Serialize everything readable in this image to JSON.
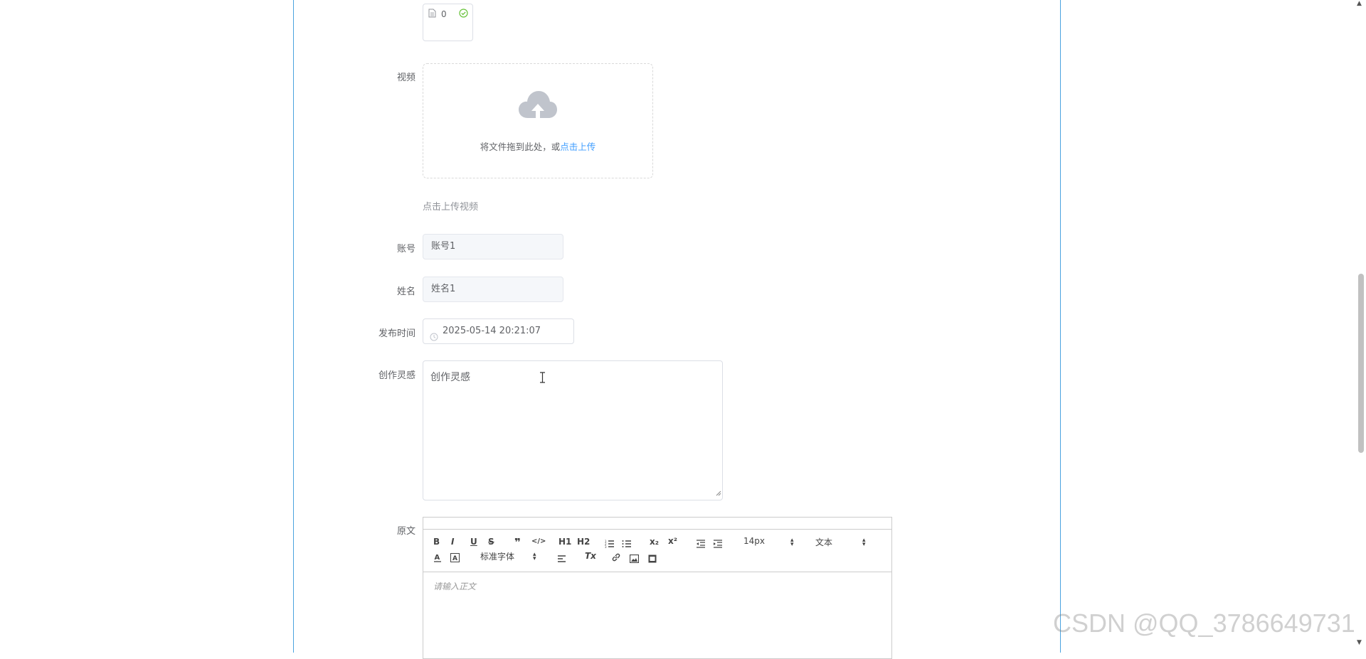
{
  "uploaded_file": {
    "name": "0"
  },
  "video": {
    "label": "视频",
    "upload_tip_prefix": "将文件拖到此处，或",
    "upload_tip_link": "点击上传",
    "hint": "点击上传视频"
  },
  "account": {
    "label": "账号",
    "value": "账号1"
  },
  "name": {
    "label": "姓名",
    "value": "姓名1"
  },
  "publish_time": {
    "label": "发布时间",
    "value": "2025-05-14 20:21:07"
  },
  "inspiration": {
    "label": "创作灵感",
    "value": "创作灵感"
  },
  "original": {
    "label": "原文",
    "toolbar": {
      "bold": "B",
      "italic": "I",
      "underline": "U",
      "strike": "S",
      "blockquote": "❞",
      "code": "</>",
      "h1": "H1",
      "h2": "H2",
      "sub": "x₂",
      "sup": "x²",
      "size_value": "14px",
      "header_value": "文本",
      "font_value": "标准字体",
      "clean": "Tx"
    },
    "placeholder": "请输入正文"
  },
  "watermark": "CSDN @QQ_3786649731"
}
